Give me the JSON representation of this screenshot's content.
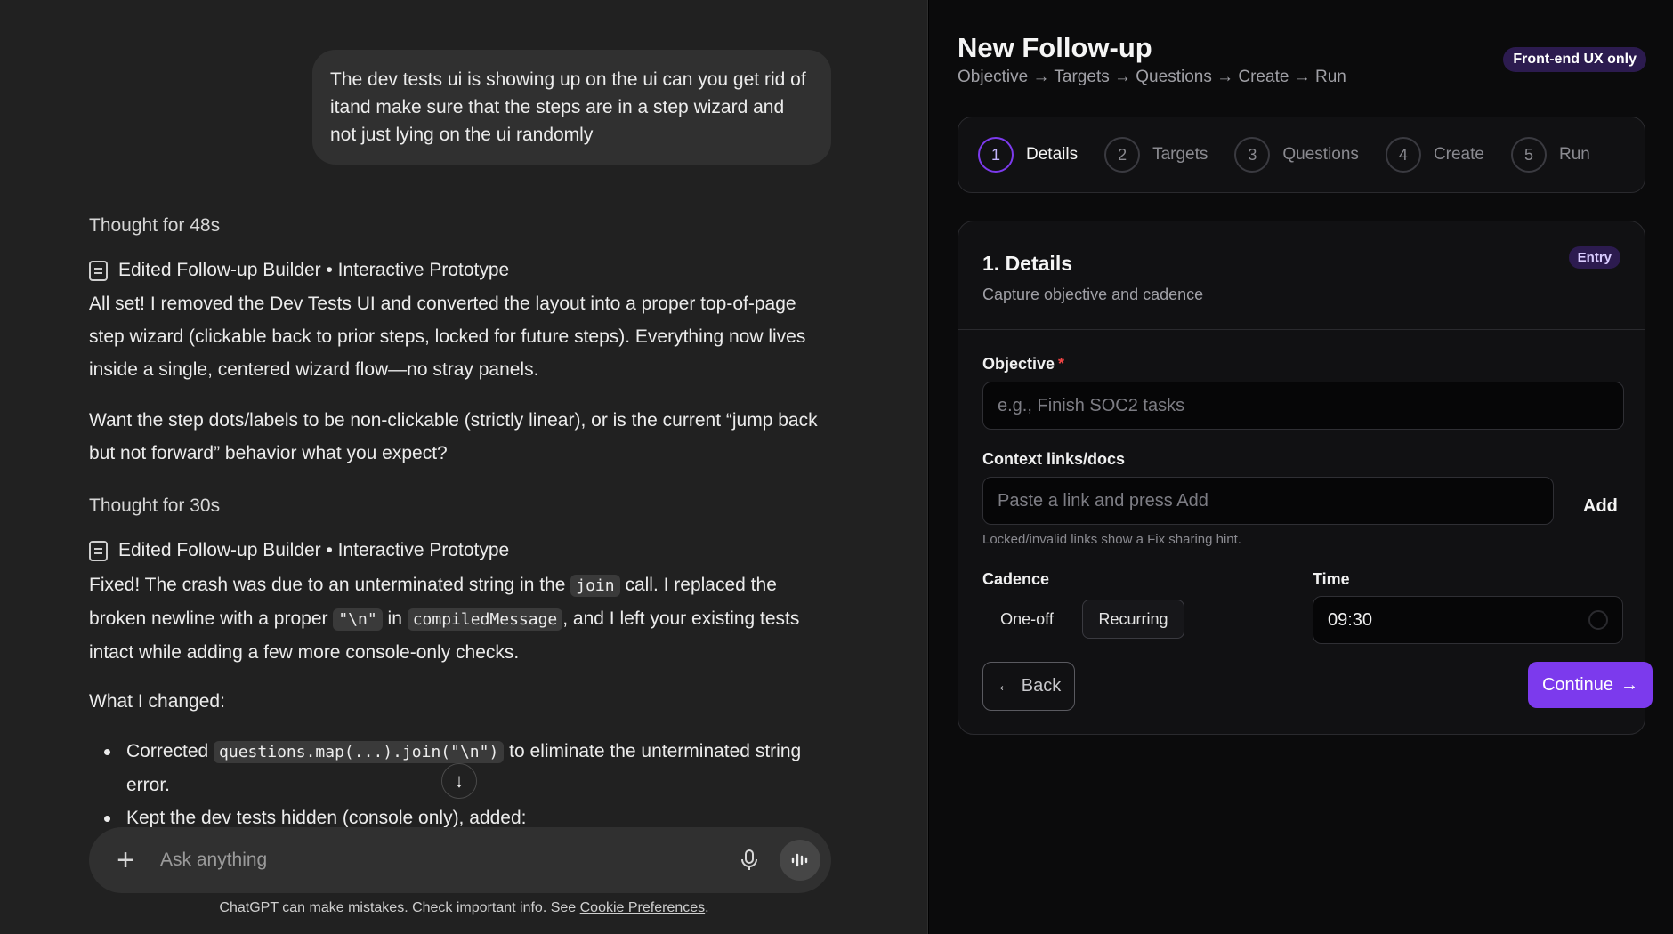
{
  "chat": {
    "user_message": "The dev tests ui is showing up on the ui can you get rid of itand make sure that the steps are in a step wizard and not just lying on the ui randomly",
    "thought_1": "Thought for 48s",
    "edited_1": "Edited Follow-up Builder • Interactive Prototype",
    "reply_1": "All set! I removed the Dev Tests UI and converted the layout into a proper top-of-page step wizard (clickable back to prior steps, locked for future steps). Everything now lives inside a single, centered wizard flow—no stray panels.",
    "reply_2": "Want the step dots/labels to be non-clickable (strictly linear), or is the current “jump back but not forward” behavior what you expect?",
    "thought_2": "Thought for 30s",
    "edited_2": "Edited Follow-up Builder • Interactive Prototype",
    "fixed": {
      "t1": "Fixed! The crash was due to an unterminated string in the ",
      "c1": "join",
      "t2": " call. I replaced the broken newline with a proper ",
      "c2": "\"\\n\"",
      "t3": " in ",
      "c3": "compiledMessage",
      "t4": ", and I left your existing tests intact while adding a few more console-only checks."
    },
    "what_changed": "What I changed:",
    "bullet_1": {
      "t1": "Corrected ",
      "c1": "questions.map(...).join(\"\\n\")",
      "t2": " to eliminate the unterminated string error."
    },
    "bullet_2": "Kept the dev tests hidden (console only), added:",
    "composer_placeholder": "Ask anything",
    "disclaimer_text": "ChatGPT can make mistakes. Check important info. See ",
    "disclaimer_link": "Cookie Preferences",
    "disclaimer_end": "."
  },
  "wizard": {
    "title": "New Follow-up",
    "breadcrumb": "Objective → Targets → Questions → Create → Run",
    "badge": "Front-end UX only",
    "steps": [
      {
        "num": "1",
        "label": "Details",
        "active": true
      },
      {
        "num": "2",
        "label": "Targets",
        "active": false
      },
      {
        "num": "3",
        "label": "Questions",
        "active": false
      },
      {
        "num": "4",
        "label": "Create",
        "active": false
      },
      {
        "num": "5",
        "label": "Run",
        "active": false
      }
    ],
    "card": {
      "title": "1. Details",
      "subtitle": "Capture objective and cadence",
      "badge": "Entry",
      "objective_label": "Objective",
      "objective_required": "*",
      "objective_placeholder": "e.g., Finish SOC2 tasks",
      "context_label": "Context links/docs",
      "context_placeholder": "Paste a link and press Add",
      "add_label": "Add",
      "hint": "Locked/invalid links show a Fix sharing hint.",
      "cadence_label": "Cadence",
      "cadence_one_off": "One-off",
      "cadence_recurring": "Recurring",
      "cadence_selected": "Recurring",
      "time_label": "Time",
      "time_value": "09:30",
      "back_label": "Back",
      "continue_label": "Continue"
    },
    "colors": {
      "accent": "#7c3aed",
      "badge_bg": "#2c1b4f",
      "required": "#ef4444"
    }
  }
}
